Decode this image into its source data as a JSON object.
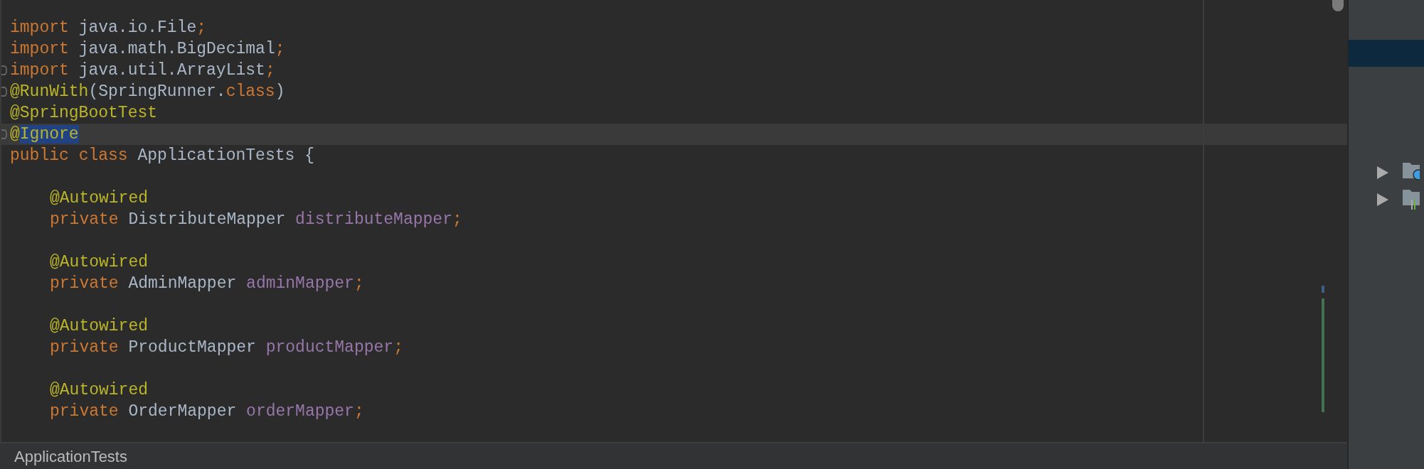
{
  "editor": {
    "lines": [
      {
        "kind": "code",
        "indented": false,
        "fold_marker": false,
        "tokens": [
          {
            "kind": "keyword",
            "text": "import",
            "selected": false
          },
          {
            "kind": "space"
          },
          {
            "kind": "plain",
            "text": "java.io.File",
            "selected": false
          },
          {
            "kind": "keyword",
            "text": ";",
            "selected": false
          }
        ]
      },
      {
        "kind": "code",
        "indented": false,
        "fold_marker": false,
        "tokens": [
          {
            "kind": "keyword",
            "text": "import",
            "selected": false
          },
          {
            "kind": "space"
          },
          {
            "kind": "plain",
            "text": "java.math.BigDecimal",
            "selected": false
          },
          {
            "kind": "keyword",
            "text": ";",
            "selected": false
          }
        ]
      },
      {
        "kind": "code",
        "indented": false,
        "fold_marker": true,
        "tokens": [
          {
            "kind": "keyword",
            "text": "import",
            "selected": false
          },
          {
            "kind": "space"
          },
          {
            "kind": "plain",
            "text": "java.util.ArrayList",
            "selected": false
          },
          {
            "kind": "keyword",
            "text": ";",
            "selected": false
          }
        ]
      },
      {
        "kind": "code",
        "indented": false,
        "fold_marker": true,
        "tokens": [
          {
            "kind": "annotation",
            "text": "@RunWith",
            "selected": false
          },
          {
            "kind": "plain",
            "text": "(SpringRunner.",
            "selected": false
          },
          {
            "kind": "keyword",
            "text": "class",
            "selected": false
          },
          {
            "kind": "plain",
            "text": ")",
            "selected": false
          }
        ]
      },
      {
        "kind": "code",
        "indented": false,
        "fold_marker": false,
        "tokens": [
          {
            "kind": "annotation",
            "text": "@SpringBootTest",
            "selected": false
          }
        ]
      },
      {
        "kind": "code",
        "current": true,
        "indented": false,
        "fold_marker": true,
        "tokens": [
          {
            "kind": "annotation",
            "text": "@",
            "selected": false
          },
          {
            "kind": "annotation",
            "text": "Ignore",
            "selected": true
          }
        ]
      },
      {
        "kind": "code",
        "indented": false,
        "fold_marker": false,
        "tokens": [
          {
            "kind": "keyword",
            "text": "public",
            "selected": false
          },
          {
            "kind": "space"
          },
          {
            "kind": "keyword",
            "text": "class",
            "selected": false
          },
          {
            "kind": "space"
          },
          {
            "kind": "plain",
            "text": "ApplicationTests",
            "selected": false
          },
          {
            "kind": "space"
          },
          {
            "kind": "plain",
            "text": "{",
            "selected": false
          }
        ]
      },
      {
        "kind": "blank"
      },
      {
        "kind": "code",
        "indented": true,
        "fold_marker": false,
        "tokens": [
          {
            "kind": "annotation",
            "text": "@Autowired",
            "selected": false
          }
        ]
      },
      {
        "kind": "code",
        "indented": true,
        "fold_marker": false,
        "tokens": [
          {
            "kind": "keyword",
            "text": "private",
            "selected": false
          },
          {
            "kind": "space"
          },
          {
            "kind": "plain",
            "text": "DistributeMapper",
            "selected": false
          },
          {
            "kind": "space"
          },
          {
            "kind": "field",
            "text": "distributeMapper",
            "selected": false
          },
          {
            "kind": "keyword",
            "text": ";",
            "selected": false
          }
        ]
      },
      {
        "kind": "blank"
      },
      {
        "kind": "code",
        "indented": true,
        "fold_marker": false,
        "tokens": [
          {
            "kind": "annotation",
            "text": "@Autowired",
            "selected": false
          }
        ]
      },
      {
        "kind": "code",
        "indented": true,
        "fold_marker": false,
        "tokens": [
          {
            "kind": "keyword",
            "text": "private",
            "selected": false
          },
          {
            "kind": "space"
          },
          {
            "kind": "plain",
            "text": "AdminMapper",
            "selected": false
          },
          {
            "kind": "space"
          },
          {
            "kind": "field",
            "text": "adminMapper",
            "selected": false
          },
          {
            "kind": "keyword",
            "text": ";",
            "selected": false
          }
        ]
      },
      {
        "kind": "blank"
      },
      {
        "kind": "code",
        "indented": true,
        "fold_marker": false,
        "tokens": [
          {
            "kind": "annotation",
            "text": "@Autowired",
            "selected": false
          }
        ]
      },
      {
        "kind": "code",
        "indented": true,
        "fold_marker": false,
        "tokens": [
          {
            "kind": "keyword",
            "text": "private",
            "selected": false
          },
          {
            "kind": "space"
          },
          {
            "kind": "plain",
            "text": "ProductMapper",
            "selected": false
          },
          {
            "kind": "space"
          },
          {
            "kind": "field",
            "text": "productMapper",
            "selected": false
          },
          {
            "kind": "keyword",
            "text": ";",
            "selected": false
          }
        ]
      },
      {
        "kind": "blank"
      },
      {
        "kind": "code",
        "indented": true,
        "fold_marker": false,
        "tokens": [
          {
            "kind": "annotation",
            "text": "@Autowired",
            "selected": false
          }
        ]
      },
      {
        "kind": "code",
        "indented": true,
        "fold_marker": false,
        "tokens": [
          {
            "kind": "keyword",
            "text": "private",
            "selected": false
          },
          {
            "kind": "space"
          },
          {
            "kind": "plain",
            "text": "OrderMapper",
            "selected": false
          },
          {
            "kind": "space"
          },
          {
            "kind": "field",
            "text": "orderMapper",
            "selected": false
          },
          {
            "kind": "keyword",
            "text": ";",
            "selected": false
          }
        ]
      }
    ]
  },
  "breadcrumb": "ApplicationTests",
  "project_tree": [
    {
      "kind": "empty",
      "selected": true
    },
    {
      "kind": "spacer",
      "selected": false
    },
    {
      "kind": "config-folder",
      "selected": false,
      "expanded": false
    },
    {
      "kind": "library-folder",
      "selected": false,
      "expanded": false
    }
  ]
}
